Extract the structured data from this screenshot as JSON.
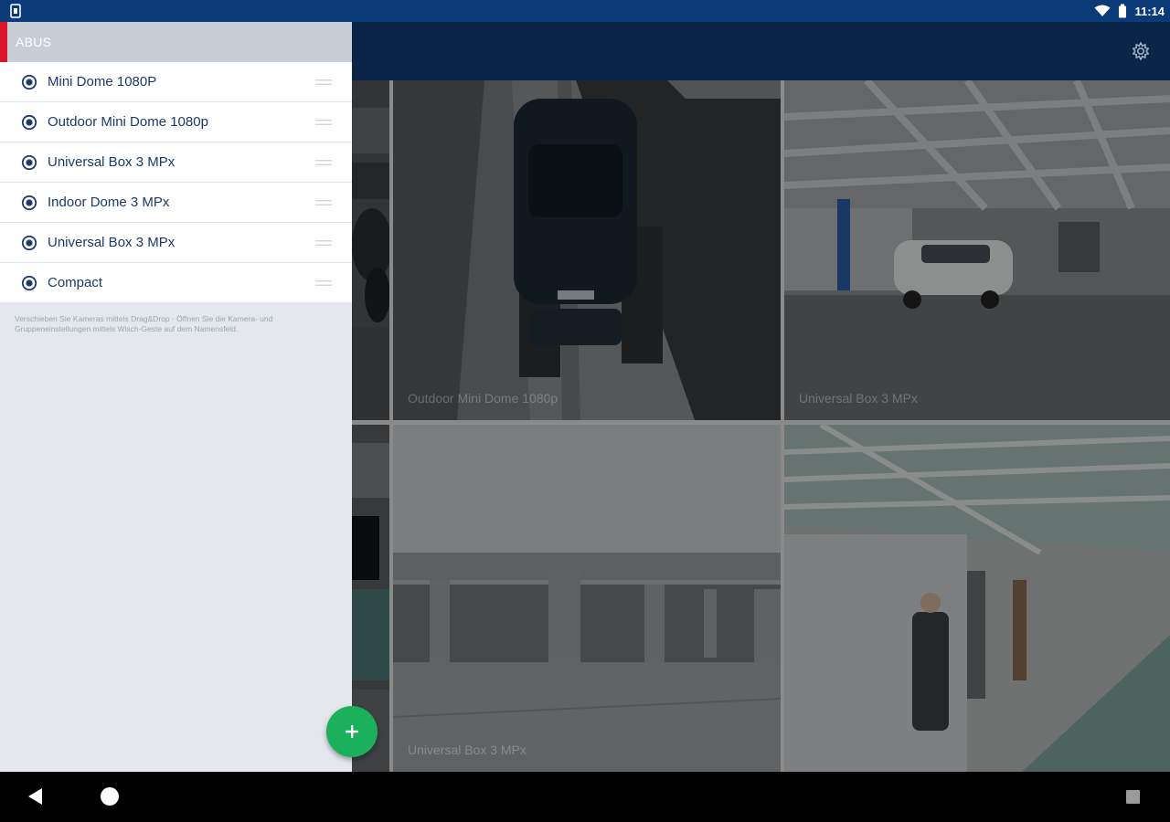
{
  "status_bar": {
    "time": "11:14",
    "icons": [
      "sim-icon",
      "wifi-icon",
      "battery-icon"
    ]
  },
  "app_bar": {
    "settings_icon": "gear-icon"
  },
  "drawer": {
    "group_title": "ABUS",
    "cameras": [
      {
        "label": "Mini Dome 1080P"
      },
      {
        "label": "Outdoor Mini Dome 1080p"
      },
      {
        "label": "Universal Box 3 MPx"
      },
      {
        "label": "Indoor Dome 3 MPx"
      },
      {
        "label": "Universal Box 3 MPx"
      },
      {
        "label": "Compact"
      }
    ],
    "hint": "Verschieben Sie Kameras mittels Drag&Drop · Öffnen Sie die Kamera- und Gruppeneinstellungen mittels Wisch-Geste auf dem Namensfeld."
  },
  "grid": {
    "tiles": [
      {
        "label": ""
      },
      {
        "label": "Outdoor Mini Dome 1080p"
      },
      {
        "label": "Universal Box 3 MPx"
      },
      {
        "label": ""
      },
      {
        "label": "Universal Box 3 MPx"
      },
      {
        "label": ""
      }
    ]
  },
  "colors": {
    "status_bar": "#0b3a78",
    "app_bar": "#0a2448",
    "accent_red": "#d9142a",
    "fab": "#1bb05c",
    "camera_text": "#1c3a6e"
  },
  "nav_bar": {
    "icons": [
      "back-icon",
      "home-icon",
      "recent-apps-icon"
    ]
  }
}
